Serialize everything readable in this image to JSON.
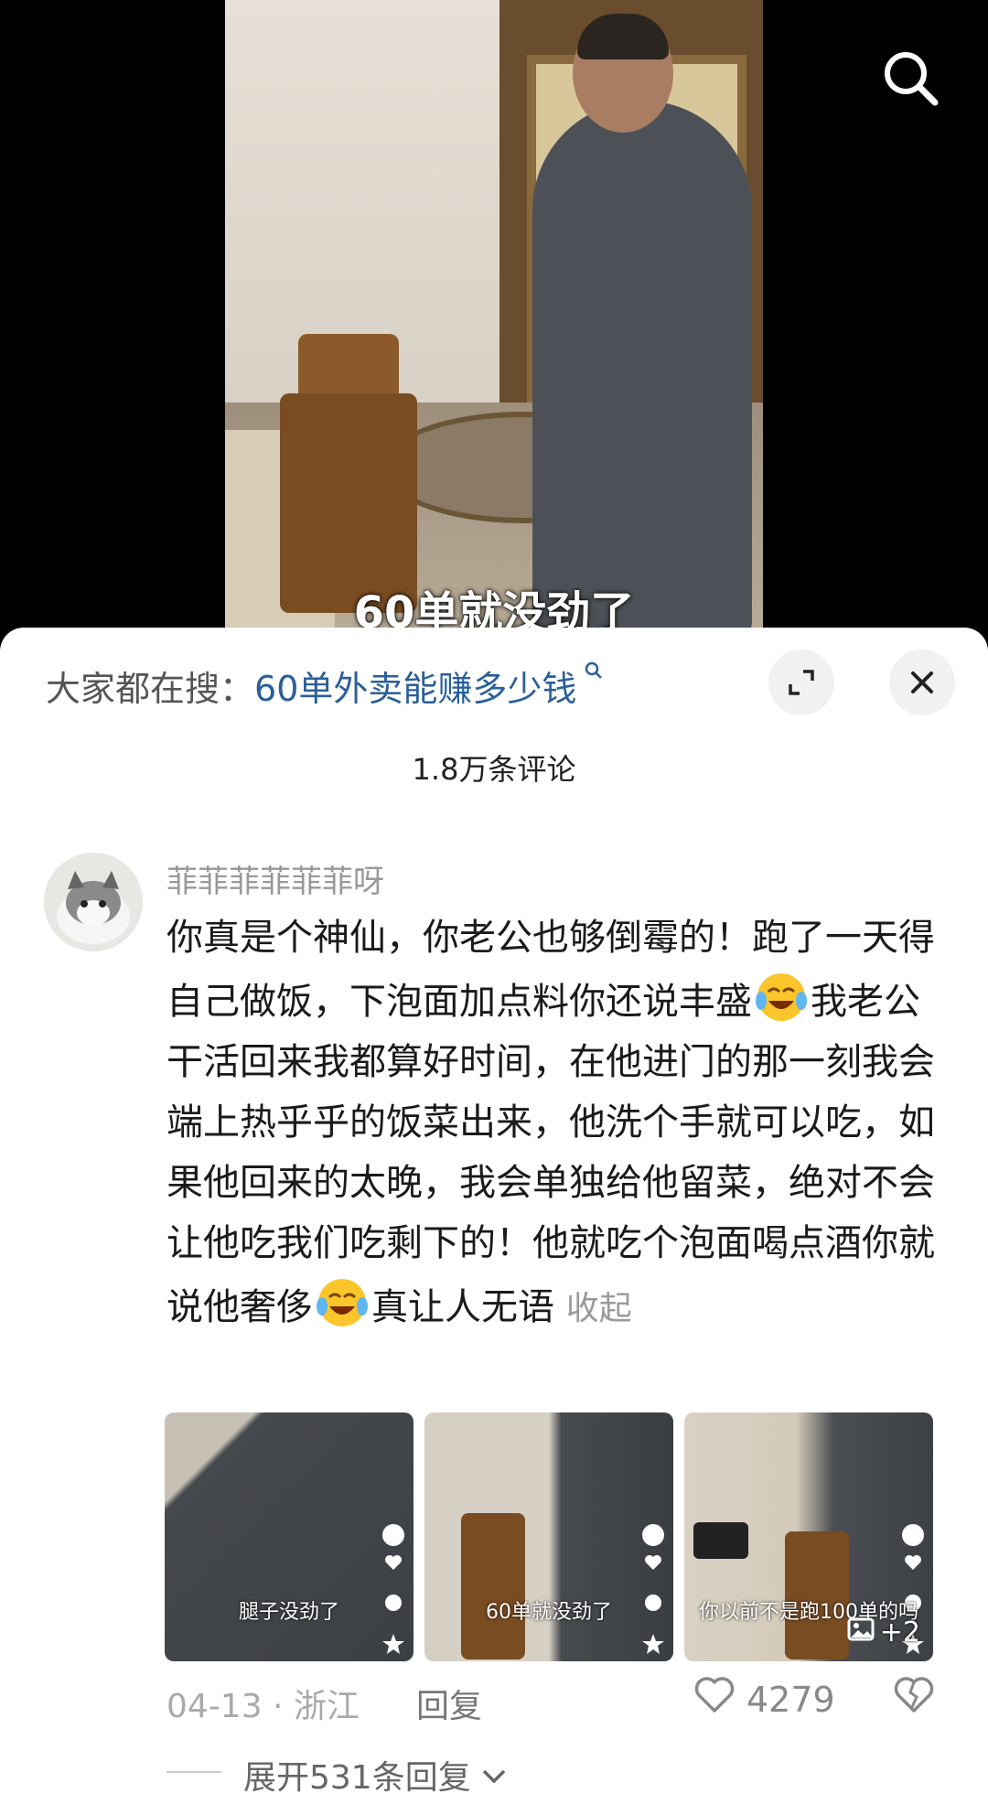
{
  "video": {
    "caption": "60单就没劲了"
  },
  "panel": {
    "hot_search_prefix": "大家都在搜：",
    "hot_search_query": "60单外卖能赚多少钱",
    "comment_count": "1.8万条评论"
  },
  "comment": {
    "username": "菲菲菲菲菲菲呀",
    "text_part1": "你真是个神仙，你老公也够倒霉的！跑了一天得自己做饭，下泡面加点料你还说丰盛",
    "text_part2": "我老公干活回来我都算好时间，在他进门的那一刻我会端上热乎乎的饭菜出来，他洗个手就可以吃，如果他回来的太晚，我会单独给他留菜，绝对不会让他吃我们吃剩下的！他就吃个泡面喝点酒你就说他奢侈",
    "text_part3": "真让人无语",
    "collapse_label": "收起",
    "thumbnails": [
      {
        "caption": "腿子没劲了"
      },
      {
        "caption": "60单就没劲了"
      },
      {
        "caption": "你以前不是跑100单的吗"
      }
    ],
    "more_images": "+2",
    "date": "04-13",
    "location": "浙江",
    "reply_label": "回复",
    "likes": "4279",
    "expand_label": "展开531条回复"
  },
  "icons": [
    "search-icon",
    "expand-icon",
    "close-icon",
    "heart-icon",
    "broken-heart-icon",
    "image-icon",
    "chevron-down-icon",
    "laughing-crying-emoji"
  ],
  "colors": {
    "accent_link": "#2a5f99",
    "muted": "#999999"
  }
}
